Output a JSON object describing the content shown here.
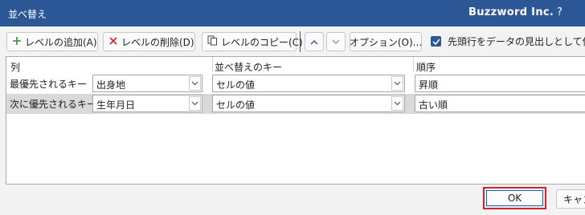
{
  "window": {
    "title": "並べ替え",
    "brand": "Buzzword Inc.",
    "help": "?"
  },
  "toolbar": {
    "add_level": "レベルの追加(A)",
    "delete_level": "レベルの削除(D)",
    "copy_level": "レベルのコピー(C)",
    "options": "オプション(O)...",
    "header_checkbox_label": "先頭行をデータの見出しとして使用す",
    "header_checkbox_checked": true
  },
  "grid": {
    "columns": [
      "列",
      "並べ替えのキー",
      "順序"
    ],
    "rows": [
      {
        "label": "最優先されるキー",
        "column": "出身地",
        "key": "セルの値",
        "order": "昇順"
      },
      {
        "label": "次に優先されるキー",
        "column": "生年月日",
        "key": "セルの値",
        "order": "古い順"
      }
    ]
  },
  "footer": {
    "ok": "OK",
    "cancel": "キャンセル"
  },
  "colors": {
    "titlebar": "#2b5797",
    "accent": "#0067c0",
    "highlight": "#d1242f"
  }
}
